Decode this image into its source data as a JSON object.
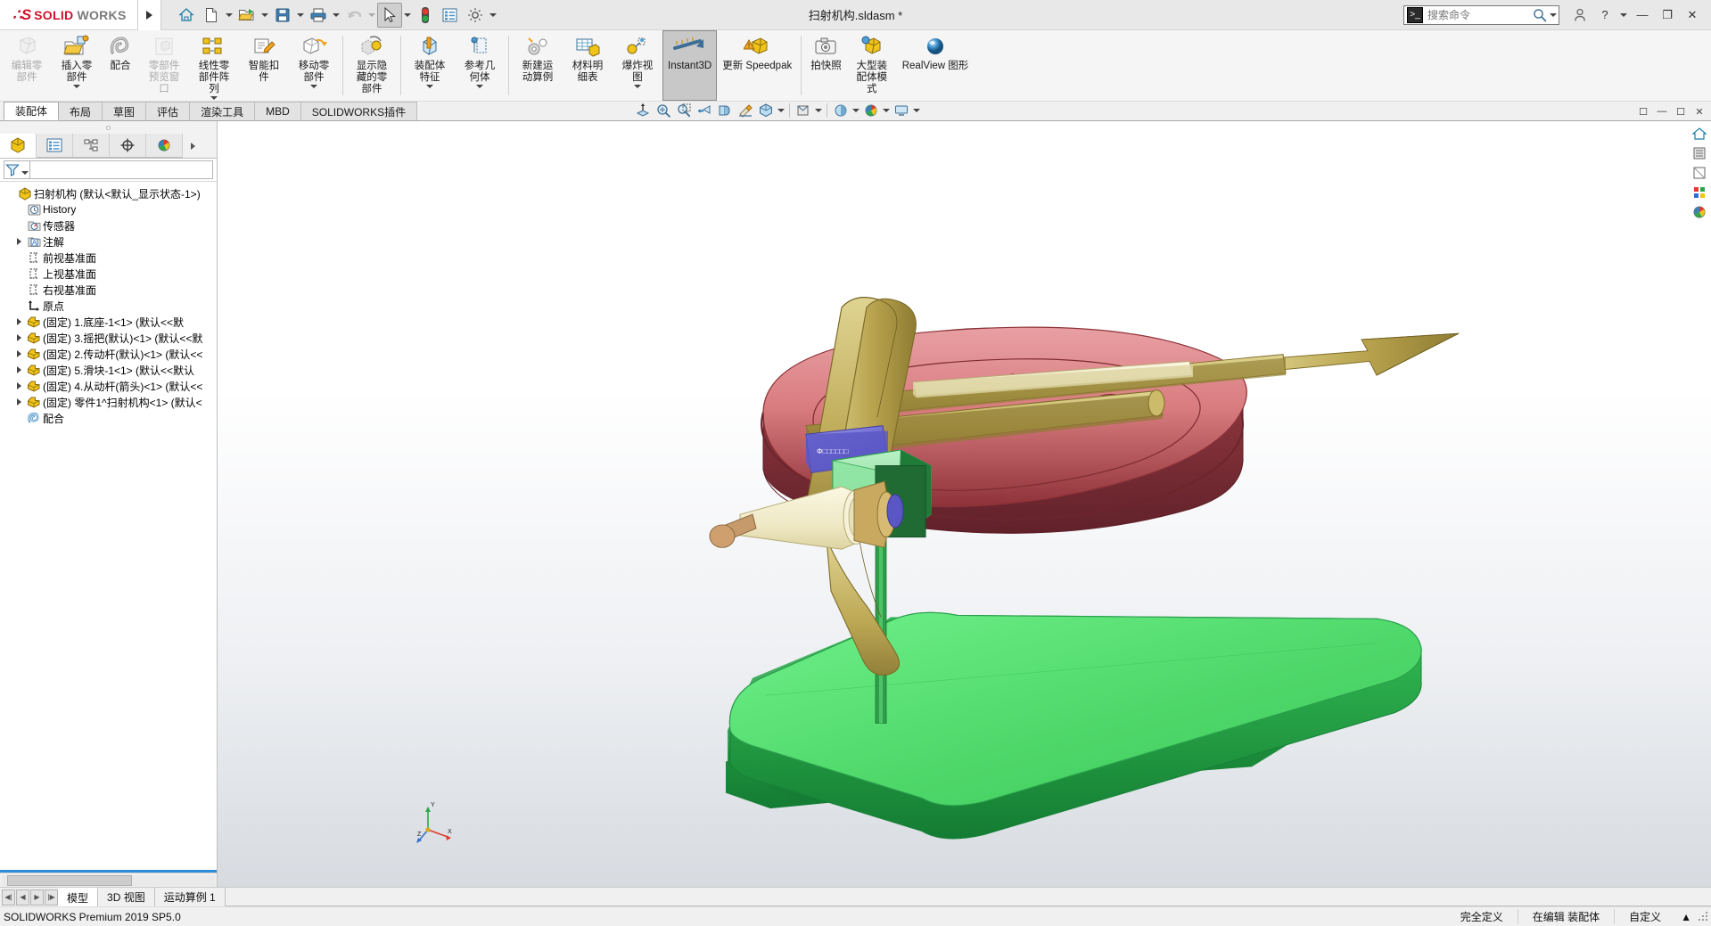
{
  "app": {
    "brand_ds": "∴S",
    "brand_solid": "SOLID",
    "brand_works": "WORKS",
    "document_title": "扫射机构.sldasm *",
    "accent_red": "#d0112b",
    "selected_blue": "#2d8cd6"
  },
  "quick_access": [
    {
      "name": "home-icon",
      "label": "主页"
    },
    {
      "name": "new-document-icon",
      "label": "新建"
    },
    {
      "name": "open-folder-icon",
      "label": "打开"
    },
    {
      "name": "save-icon",
      "label": "保存"
    },
    {
      "name": "print-icon",
      "label": "打印"
    },
    {
      "name": "undo-icon",
      "label": "撤销"
    },
    {
      "name": "select-cursor-icon",
      "label": "选择"
    },
    {
      "name": "rebuild-icon",
      "label": "重建模型"
    },
    {
      "name": "options-list-icon",
      "label": "文件属性"
    },
    {
      "name": "gear-icon",
      "label": "选项"
    }
  ],
  "search": {
    "placeholder": "搜索命令",
    "prompt_glyph": ">_"
  },
  "window_controls": {
    "user": "用户",
    "help": "?",
    "minimize": "—",
    "restore": "❐",
    "close": "✕"
  },
  "ribbon": {
    "buttons": [
      {
        "label": "编辑零部件",
        "icon": "edit-component-icon",
        "disabled": true,
        "caret": false,
        "wide": false
      },
      {
        "label": "插入零部件",
        "icon": "insert-component-icon",
        "disabled": false,
        "caret": true,
        "wide": false
      },
      {
        "label": "配合",
        "icon": "mate-icon",
        "disabled": false,
        "caret": false,
        "wide": false
      },
      {
        "label": "零部件预览窗口",
        "icon": "component-preview-window-icon",
        "disabled": true,
        "caret": false,
        "wide": false
      },
      {
        "label": "线性零部件阵列",
        "icon": "linear-component-pattern-icon",
        "disabled": false,
        "caret": true,
        "wide": false
      },
      {
        "label": "智能扣件",
        "icon": "smart-fasteners-icon",
        "disabled": false,
        "caret": false,
        "wide": false
      },
      {
        "label": "移动零部件",
        "icon": "move-component-icon",
        "disabled": false,
        "caret": true,
        "wide": false
      },
      {
        "separator": true
      },
      {
        "label": "显示隐藏的零部件",
        "icon": "show-hidden-components-icon",
        "disabled": false,
        "caret": false,
        "wide": false
      },
      {
        "separator": true
      },
      {
        "label": "装配体特征",
        "icon": "assembly-features-icon",
        "disabled": false,
        "caret": true,
        "wide": false
      },
      {
        "label": "参考几何体",
        "icon": "reference-geometry-icon",
        "disabled": false,
        "caret": true,
        "wide": false
      },
      {
        "separator": true
      },
      {
        "label": "新建运动算例",
        "icon": "new-motion-study-icon",
        "disabled": false,
        "caret": false,
        "wide": false
      },
      {
        "label": "材料明细表",
        "icon": "bill-of-materials-icon",
        "disabled": false,
        "caret": false,
        "wide": false
      },
      {
        "label": "爆炸视图",
        "icon": "exploded-view-icon",
        "disabled": false,
        "caret": true,
        "wide": false
      },
      {
        "label": "Instant3D",
        "icon": "instant3d-icon",
        "disabled": false,
        "caret": false,
        "wide": true,
        "selected": true
      },
      {
        "label": "更新 Speedpak",
        "icon": "update-speedpak-icon",
        "disabled": false,
        "caret": false,
        "wide": true
      },
      {
        "separator": true
      },
      {
        "label": "拍快照",
        "icon": "take-snapshot-icon",
        "disabled": false,
        "caret": false,
        "wide": false
      },
      {
        "label": "大型装配体模式",
        "icon": "large-assembly-mode-icon",
        "disabled": false,
        "caret": false,
        "wide": false
      },
      {
        "label": "RealView 图形",
        "icon": "realview-graphics-icon",
        "disabled": false,
        "caret": false,
        "wide": true
      }
    ]
  },
  "tabs": [
    {
      "label": "装配体",
      "active": true
    },
    {
      "label": "布局",
      "active": false
    },
    {
      "label": "草图",
      "active": false
    },
    {
      "label": "评估",
      "active": false
    },
    {
      "label": "渲染工具",
      "active": false
    },
    {
      "label": "MBD",
      "active": false
    },
    {
      "label": "SOLIDWORKS插件",
      "active": false
    }
  ],
  "view_toolbar": [
    {
      "name": "zoom-to-fit-icon",
      "label": "整屏显示全图"
    },
    {
      "name": "zoom-to-area-icon",
      "label": "局部放大"
    },
    {
      "name": "previous-view-icon",
      "label": "上一视图"
    },
    {
      "name": "section-view-icon",
      "label": "剖面视图"
    },
    {
      "name": "view-orientation-icon",
      "label": "视向"
    },
    {
      "name": "display-style-icon",
      "label": "显示样式"
    },
    {
      "name": "hide-show-items-icon",
      "label": "隐藏/显示项目"
    },
    {
      "name": "edit-appearance-icon",
      "label": "编辑外观"
    },
    {
      "name": "apply-scene-icon",
      "label": "应用场景"
    },
    {
      "name": "view-settings-icon",
      "label": "视图设定"
    }
  ],
  "feature_manager": {
    "tabs": [
      {
        "name": "feature-manager-design-tree-tab",
        "active": true
      },
      {
        "name": "property-manager-tab",
        "active": false
      },
      {
        "name": "configuration-manager-tab",
        "active": false
      },
      {
        "name": "dimxpert-manager-tab",
        "active": false
      },
      {
        "name": "display-manager-tab",
        "active": false
      }
    ],
    "filter_placeholder": "",
    "tree": [
      {
        "label": "扫射机构  (默认<默认_显示状态-1>)",
        "icon": "assembly-icon",
        "indent": 0,
        "expandable": false,
        "root": true
      },
      {
        "label": "History",
        "icon": "history-icon",
        "indent": 1,
        "expandable": false
      },
      {
        "label": "传感器",
        "icon": "sensors-icon",
        "indent": 1,
        "expandable": false
      },
      {
        "label": "注解",
        "icon": "annotations-icon",
        "indent": 1,
        "expandable": true
      },
      {
        "label": "前视基准面",
        "icon": "plane-icon",
        "indent": 1,
        "expandable": false
      },
      {
        "label": "上视基准面",
        "icon": "plane-icon",
        "indent": 1,
        "expandable": false
      },
      {
        "label": "右视基准面",
        "icon": "plane-icon",
        "indent": 1,
        "expandable": false
      },
      {
        "label": "原点",
        "icon": "origin-icon",
        "indent": 1,
        "expandable": false
      },
      {
        "label": "(固定) 1.底座-1<1>  (默认<<默",
        "icon": "part-icon",
        "indent": 1,
        "expandable": true
      },
      {
        "label": "(固定) 3.摇把(默认)<1>  (默认<<默",
        "icon": "part-icon",
        "indent": 1,
        "expandable": true
      },
      {
        "label": "(固定) 2.传动杆(默认)<1>  (默认<<",
        "icon": "part-icon",
        "indent": 1,
        "expandable": true
      },
      {
        "label": "(固定) 5.滑块-1<1>  (默认<<默认",
        "icon": "part-icon",
        "indent": 1,
        "expandable": true
      },
      {
        "label": "(固定) 4.从动杆(箭头)<1>  (默认<<",
        "icon": "part-icon",
        "indent": 1,
        "expandable": true
      },
      {
        "label": "(固定) 零件1^扫射机构<1>  (默认<",
        "icon": "part-icon",
        "indent": 1,
        "expandable": true
      },
      {
        "label": "配合",
        "icon": "mates-folder-icon",
        "indent": 1,
        "expandable": false
      }
    ]
  },
  "graphics": {
    "triad_labels": {
      "x": "X",
      "y": "Y",
      "z": "Z"
    },
    "dimension_text": "Φ□□□□□□□",
    "colors": {
      "base_plate_green": "#4fd86a",
      "base_plate_dark": "#1f9e3f",
      "ring_red": "#d97c80",
      "ring_dark_red": "#7e2b31",
      "rod_olive": "#b7a24d",
      "rod_light": "#d9d28a",
      "slider_blue": "#6e6ad6",
      "slider_green": "#8ee6a0",
      "slider_dark_green": "#245f33",
      "cream": "#f2edd5",
      "tan": "#c79a6b"
    }
  },
  "bottom_tabs": [
    {
      "label": "模型",
      "active": true
    },
    {
      "label": "3D 视图",
      "active": false
    },
    {
      "label": "运动算例 1",
      "active": false
    }
  ],
  "status_bar": {
    "left": "SOLIDWORKS Premium 2019 SP5.0",
    "state": "完全定义",
    "edit_mode": "在编辑 装配体",
    "units": "自定义",
    "units_caret": "▲"
  }
}
